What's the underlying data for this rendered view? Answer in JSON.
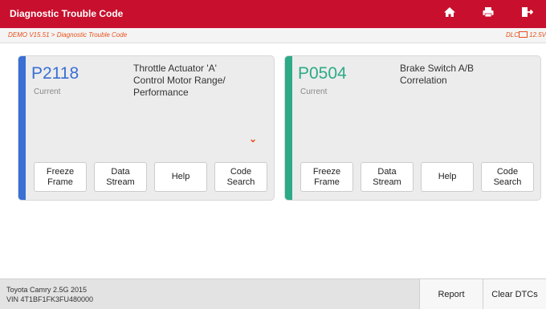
{
  "header": {
    "title": "Diagnostic Trouble Code",
    "icons": [
      "home-icon",
      "print-icon",
      "exit-icon"
    ]
  },
  "breadcrumb": {
    "path": "DEMO V15.51 > Diagnostic Trouble Code",
    "dlc_label": "DLC",
    "voltage": "12.5V"
  },
  "dtcs": [
    {
      "code": "P2118",
      "status": "Current",
      "description_lines": [
        "Throttle Actuator 'A'",
        "Control Motor Range/",
        "Performance"
      ],
      "accent": "#3a6fd4",
      "buttons": [
        {
          "line1": "Freeze",
          "line2": "Frame"
        },
        {
          "line1": "Data",
          "line2": "Stream"
        },
        {
          "line1": "Help",
          "line2": ""
        },
        {
          "line1": "Code",
          "line2": "Search"
        }
      ]
    },
    {
      "code": "P0504",
      "status": "Current",
      "description_lines": [
        "Brake Switch A/B",
        "Correlation",
        ""
      ],
      "accent": "#2daa86",
      "buttons": [
        {
          "line1": "Freeze",
          "line2": "Frame"
        },
        {
          "line1": "Data",
          "line2": "Stream"
        },
        {
          "line1": "Help",
          "line2": ""
        },
        {
          "line1": "Code",
          "line2": "Search"
        }
      ]
    }
  ],
  "footer": {
    "vehicle_line1": "Toyota Camry 2.5G 2015",
    "vehicle_line2": "VIN 4T1BF1FK3FU480000",
    "report_label": "Report",
    "clear_label": "Clear DTCs"
  },
  "colors": {
    "header_bg": "#c8102e",
    "breadcrumb_text": "#e8501a"
  }
}
